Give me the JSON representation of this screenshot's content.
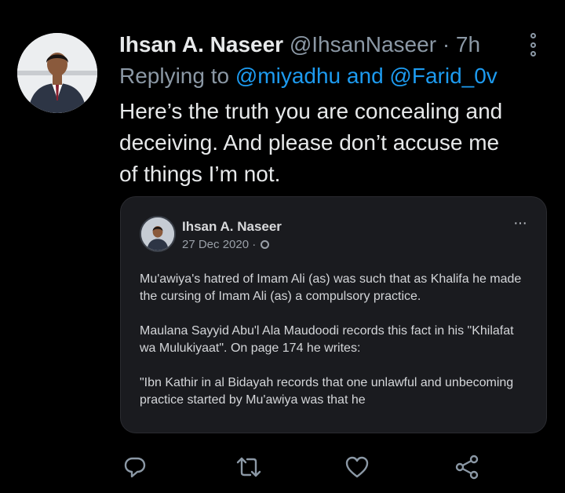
{
  "tweet": {
    "author_name": "Ihsan A. Naseer",
    "author_handle": "@IhsanNaseer",
    "separator": "·",
    "time": "7h",
    "replying_prefix": "Replying to",
    "mention_1": "@miyadhu",
    "and_word": "and",
    "mention_2": "@Farid_0v",
    "text_line_1": "Here’s the truth you are concealing and",
    "text_line_2": "deceiving. And please don’t accuse me",
    "text_line_3": "of things I’m not."
  },
  "embedded_post": {
    "author_name": "Ihsan A. Naseer",
    "date": "27 Dec 2020 ·",
    "more": "···",
    "paragraph_1": "Mu'awiya's hatred of Imam Ali (as) was such that as Khalifa he made the cursing of Imam Ali (as) a compulsory practice.",
    "paragraph_2": "Maulana Sayyid Abu'l Ala Maudoodi records this fact in his \"Khilafat wa Mulukiyaat\". On page 174 he writes:",
    "paragraph_3": "\"Ibn Kathir in al Bidayah records that one unlawful and unbecoming practice started by Mu'awiya was that he"
  },
  "actions": [
    "reply-icon",
    "retweet-icon",
    "like-icon",
    "share-icon"
  ],
  "colors": {
    "background": "#000000",
    "text": "#e7e9ea",
    "muted": "#8b98a5",
    "link": "#1d9bf0",
    "embed_bg": "#1a1b1f"
  }
}
